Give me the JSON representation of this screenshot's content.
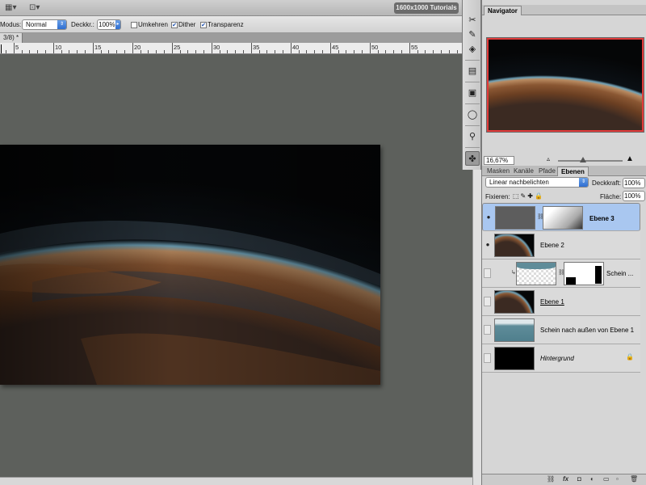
{
  "appbar": {
    "arrange_icon": "arrange-icon",
    "screen_icon": "screen-mode-icon",
    "workspace_label": "1600x1000 Tutorials"
  },
  "options": {
    "modus_label": "Modus:",
    "modus_value": "Normal",
    "deckkr_label": "Deckkr.:",
    "deckkr_value": "100%",
    "umkehren_label": "Umkehren",
    "umkehren_checked": false,
    "dither_label": "Dither",
    "dither_checked": true,
    "transparenz_label": "Transparenz",
    "transparenz_checked": true
  },
  "document": {
    "tab_title": "3/8) *"
  },
  "ruler": {
    "labels": [
      "5",
      "10",
      "15",
      "20",
      "25",
      "30",
      "35",
      "40",
      "45",
      "50",
      "55"
    ]
  },
  "tools": {
    "items": [
      "scissors-icon",
      "eyedropper-icon",
      "cube-icon",
      "histogram-icon",
      "info-icon",
      "rotate-icon",
      "clone-source-icon",
      "brush-presets-icon"
    ]
  },
  "navigator": {
    "tab_label": "Navigator",
    "zoom_value": "16,67%"
  },
  "layers_panel": {
    "tabs": [
      "Masken",
      "Kanäle",
      "Pfade",
      "Ebenen"
    ],
    "active_tab": "Ebenen",
    "blend_mode": "Linear nachbelichten",
    "opacity_label": "Deckkraft:",
    "opacity_value": "100%",
    "lock_label": "Fixieren:",
    "fill_label": "Fläche:",
    "fill_value": "100%",
    "layers": [
      {
        "name": "Ebene 3",
        "visible": true,
        "selected": true
      },
      {
        "name": "Ebene 2",
        "visible": true,
        "selected": false
      },
      {
        "name": "Schein ...",
        "visible": false,
        "selected": false
      },
      {
        "name": "Ebene 1",
        "visible": false,
        "selected": false
      },
      {
        "name": "Schein nach außen von Ebene 1",
        "visible": false,
        "selected": false
      },
      {
        "name": "Hintergrund",
        "visible": false,
        "selected": false
      }
    ]
  },
  "colors": {
    "selection": "#a9c7f0",
    "canvas_bg": "#5d605c",
    "nav_frame": "#e23b3b"
  }
}
